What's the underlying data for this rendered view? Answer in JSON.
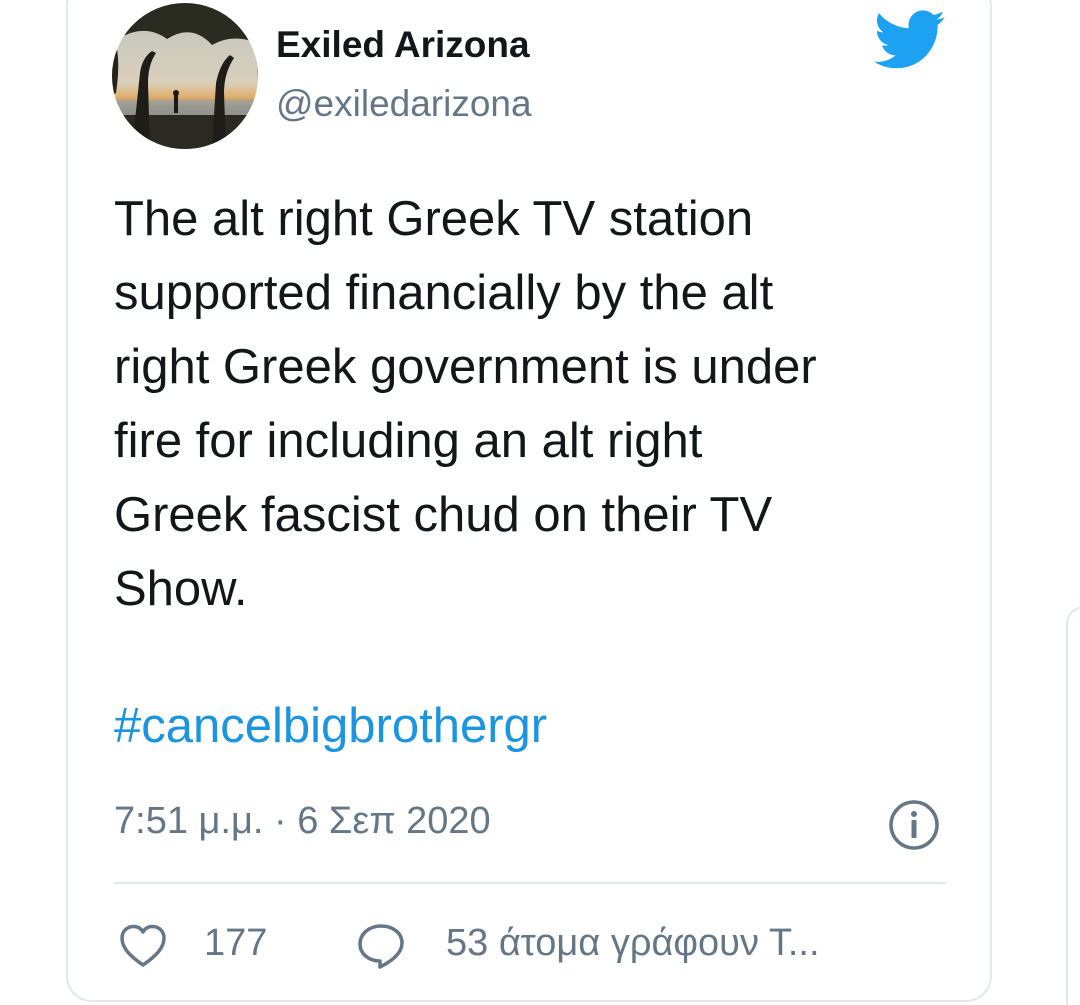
{
  "tweet": {
    "author": {
      "display_name": "Exiled Arizona",
      "handle": "@exiledarizona",
      "avatar_icon": "avatar-photo"
    },
    "brand_icon": "twitter-bird-icon",
    "text": "The alt right Greek TV station\nsupported financially by the alt\nright Greek government is under\nfire for including an alt right\nGreek fascist chud on their TV\nShow.",
    "hashtag": "#cancelbigbrothergr",
    "timestamp": "7:51 μ.μ. · 6 Σεπ 2020",
    "info_icon": "info-icon",
    "actions": {
      "like_icon": "heart-icon",
      "like_count": "177",
      "reply_icon": "speech-bubble-icon",
      "reply_text": "53 άτομα γράφουν Τ..."
    }
  },
  "colors": {
    "text": "#14171a",
    "secondary": "#657786",
    "link": "#1b95e0",
    "brand": "#1da1f2",
    "border": "#e1e8ed"
  }
}
